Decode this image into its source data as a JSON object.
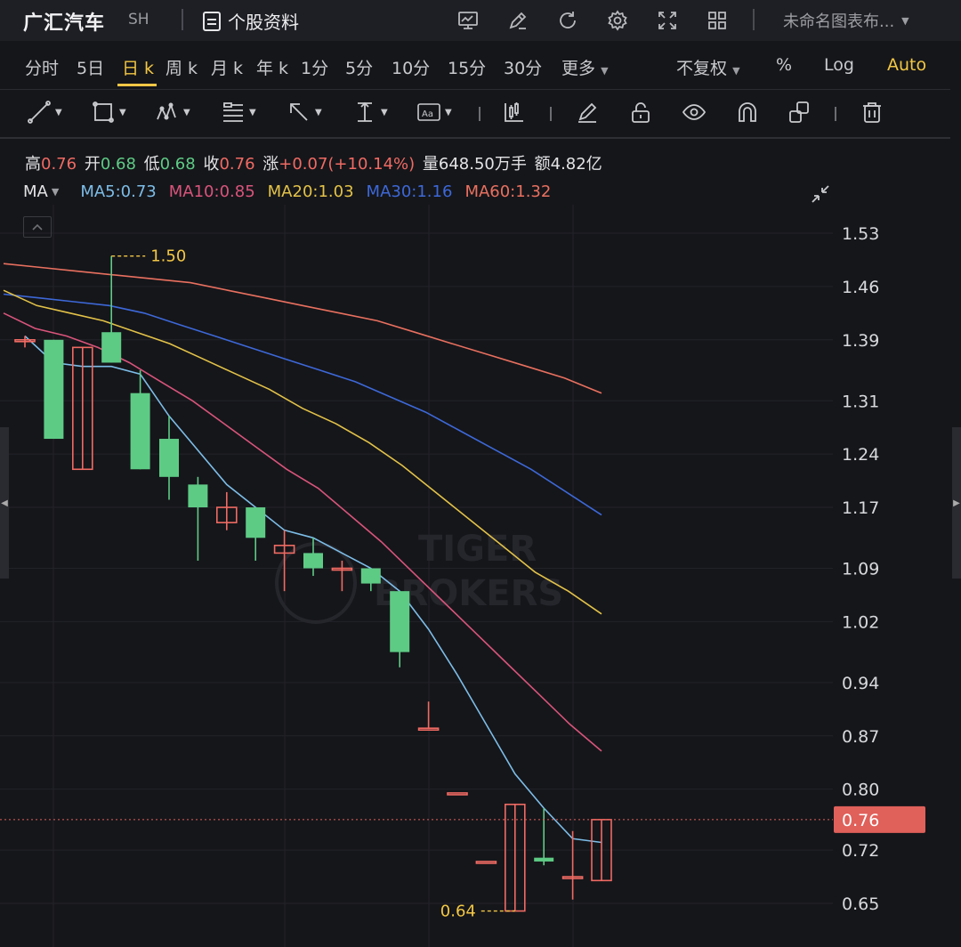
{
  "header": {
    "stock_name": "广汇汽车",
    "market": "SH",
    "profile_label": "个股资料",
    "chart_name": "未命名图表布...",
    "icons": [
      "chart-settings-icon",
      "edit-icon",
      "refresh-icon",
      "gear-icon",
      "fullscreen-icon",
      "layout-grid-icon"
    ]
  },
  "periods": [
    {
      "label": "分时",
      "active": false
    },
    {
      "label": "5日",
      "active": false
    },
    {
      "label": "日 k",
      "active": true
    },
    {
      "label": "周 k",
      "active": false
    },
    {
      "label": "月 k",
      "active": false
    },
    {
      "label": "年 k",
      "active": false
    },
    {
      "label": "1分",
      "active": false
    },
    {
      "label": "5分",
      "active": false
    },
    {
      "label": "10分",
      "active": false
    },
    {
      "label": "15分",
      "active": false
    },
    {
      "label": "30分",
      "active": false
    },
    {
      "label": "更多",
      "active": false
    }
  ],
  "options": {
    "adjust": "不复权",
    "percent": "%",
    "log": "Log",
    "auto": "Auto"
  },
  "tools": [
    "line-tool-icon",
    "rectangle-tool-icon",
    "pattern-tool-icon",
    "fib-tool-icon",
    "arrow-tool-icon",
    "measure-tool-icon",
    "text-tool-icon",
    "candle-style-icon",
    "brush-icon",
    "lock-icon",
    "eye-icon",
    "magnet-icon",
    "layers-icon",
    "trash-icon"
  ],
  "quote": {
    "high_label": "高",
    "high": "0.76",
    "open_label": "开",
    "open": "0.68",
    "low_label": "低",
    "low": "0.68",
    "close_label": "收",
    "close": "0.76",
    "change_label": "涨",
    "change": "+0.07(+10.14%)",
    "volume_label": "量",
    "volume": "648.50万手",
    "amount_label": "额",
    "amount": "4.82亿"
  },
  "ma_legend": {
    "selector": "MA",
    "items": [
      {
        "text": "MA5:0.73",
        "color": "#7dbde8"
      },
      {
        "text": "MA10:0.85",
        "color": "#d9547b"
      },
      {
        "text": "MA20:1.03",
        "color": "#e3c248"
      },
      {
        "text": "MA30:1.16",
        "color": "#3d68d8"
      },
      {
        "text": "MA60:1.32",
        "color": "#e9705f"
      }
    ]
  },
  "colors": {
    "up": "#f06a63",
    "down": "#5ecb85",
    "ma5": "#7dbde8",
    "ma10": "#d9547b",
    "ma20": "#e3c248",
    "ma30": "#3d68d8",
    "ma60": "#e9705f",
    "last_price_bg": "#e0605a",
    "annotation": "#f3c744"
  },
  "watermark": [
    "TIGER",
    "BROKERS"
  ],
  "chart_data": {
    "type": "candlestick",
    "y_ticks": [
      "1.53",
      "1.46",
      "1.39",
      "1.31",
      "1.24",
      "1.17",
      "1.09",
      "1.02",
      "0.94",
      "0.87",
      "0.80",
      "0.72",
      "0.65"
    ],
    "y_range": [
      0.6,
      1.56
    ],
    "last_price": "0.76",
    "high_annotation": "1.50",
    "low_annotation": "0.64",
    "candles": [
      {
        "o": 1.39,
        "h": 1.395,
        "l": 1.38,
        "c": 1.39
      },
      {
        "o": 1.39,
        "h": 1.39,
        "l": 1.26,
        "c": 1.26
      },
      {
        "o": 1.22,
        "h": 1.38,
        "l": 1.22,
        "c": 1.38
      },
      {
        "o": 1.4,
        "h": 1.5,
        "l": 1.36,
        "c": 1.36
      },
      {
        "o": 1.32,
        "h": 1.35,
        "l": 1.22,
        "c": 1.22
      },
      {
        "o": 1.26,
        "h": 1.29,
        "l": 1.18,
        "c": 1.21
      },
      {
        "o": 1.2,
        "h": 1.21,
        "l": 1.1,
        "c": 1.17
      },
      {
        "o": 1.15,
        "h": 1.19,
        "l": 1.14,
        "c": 1.17
      },
      {
        "o": 1.17,
        "h": 1.17,
        "l": 1.1,
        "c": 1.13
      },
      {
        "o": 1.11,
        "h": 1.14,
        "l": 1.06,
        "c": 1.12
      },
      {
        "o": 1.11,
        "h": 1.13,
        "l": 1.08,
        "c": 1.09
      },
      {
        "o": 1.09,
        "h": 1.1,
        "l": 1.06,
        "c": 1.09
      },
      {
        "o": 1.09,
        "h": 1.09,
        "l": 1.06,
        "c": 1.07
      },
      {
        "o": 1.06,
        "h": 1.06,
        "l": 0.96,
        "c": 0.98
      },
      {
        "o": 0.88,
        "h": 0.915,
        "l": 0.88,
        "c": 0.88
      },
      {
        "o": 0.795,
        "h": 0.795,
        "l": 0.795,
        "c": 0.795
      },
      {
        "o": 0.705,
        "h": 0.705,
        "l": 0.705,
        "c": 0.705
      },
      {
        "o": 0.64,
        "h": 0.78,
        "l": 0.64,
        "c": 0.78
      },
      {
        "o": 0.71,
        "h": 0.775,
        "l": 0.7,
        "c": 0.705
      },
      {
        "o": 0.685,
        "h": 0.745,
        "l": 0.655,
        "c": 0.685
      },
      {
        "o": 0.68,
        "h": 0.76,
        "l": 0.68,
        "c": 0.76
      }
    ],
    "ma5": [
      1.395,
      1.36,
      1.355,
      1.355,
      1.345,
      1.29,
      1.245,
      1.2,
      1.17,
      1.14,
      1.13,
      1.11,
      1.09,
      1.06,
      1.01,
      0.95,
      0.885,
      0.82,
      0.775,
      0.735,
      0.73
    ],
    "ma10": [
      1.425,
      1.405,
      1.395,
      1.38,
      1.36,
      1.335,
      1.31,
      1.28,
      1.25,
      1.22,
      1.195,
      1.16,
      1.125,
      1.085,
      1.045,
      1.005,
      0.965,
      0.925,
      0.885,
      0.85
    ],
    "ma20": [
      1.455,
      1.435,
      1.425,
      1.415,
      1.4,
      1.385,
      1.365,
      1.345,
      1.325,
      1.3,
      1.28,
      1.255,
      1.225,
      1.19,
      1.155,
      1.12,
      1.085,
      1.06,
      1.03
    ],
    "ma30": [
      1.45,
      1.445,
      1.44,
      1.435,
      1.425,
      1.41,
      1.395,
      1.38,
      1.365,
      1.35,
      1.335,
      1.315,
      1.295,
      1.27,
      1.245,
      1.22,
      1.19,
      1.16
    ],
    "ma60": [
      1.49,
      1.485,
      1.48,
      1.475,
      1.47,
      1.465,
      1.455,
      1.445,
      1.435,
      1.425,
      1.415,
      1.4,
      1.385,
      1.37,
      1.355,
      1.34,
      1.32
    ]
  }
}
